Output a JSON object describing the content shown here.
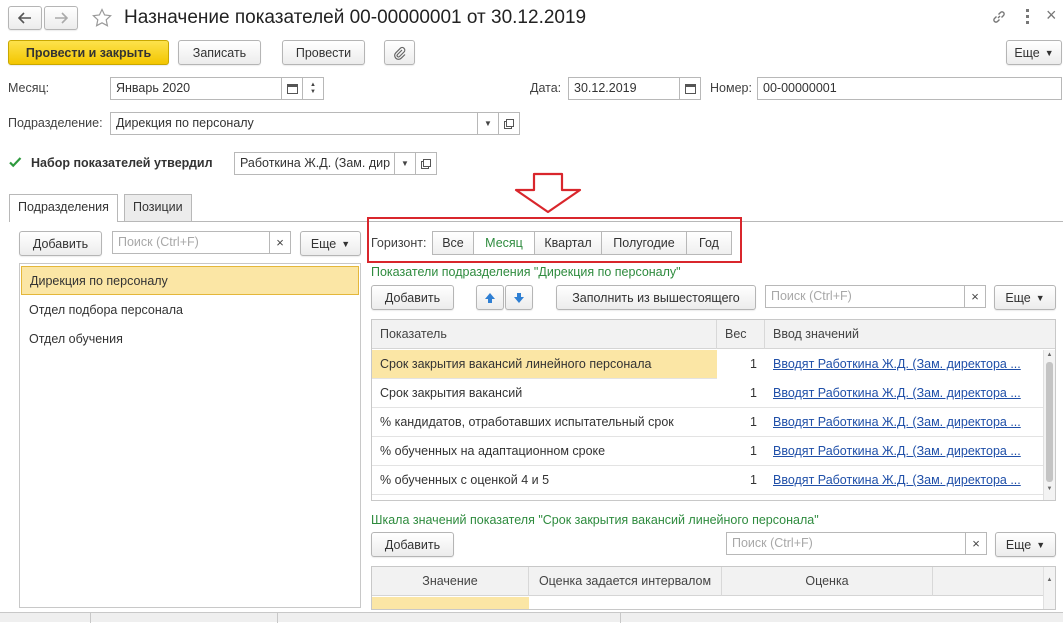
{
  "window": {
    "title": "Назначение показателей 00-00000001 от 30.12.2019"
  },
  "toolbar": {
    "post_close": "Провести и закрыть",
    "save": "Записать",
    "post": "Провести",
    "more": "Еще"
  },
  "form": {
    "month_label": "Месяц:",
    "month_value": "Январь 2020",
    "date_label": "Дата:",
    "date_value": "30.12.2019",
    "number_label": "Номер:",
    "number_value": "00-00000001",
    "dept_label": "Подразделение:",
    "dept_value": "Дирекция по персоналу",
    "approved_label": "Набор показателей утвердил",
    "approved_value": "Работкина Ж.Д. (Зам. дир"
  },
  "tabs": [
    {
      "label": "Подразделения"
    },
    {
      "label": "Позиции"
    }
  ],
  "left": {
    "add": "Добавить",
    "search_placeholder": "Поиск (Ctrl+F)",
    "more": "Еще",
    "items": [
      "Дирекция по персоналу",
      "Отдел подбора персонала",
      "Отдел обучения"
    ]
  },
  "horizon": {
    "label": "Горизонт:",
    "options": [
      "Все",
      "Месяц",
      "Квартал",
      "Полугодие",
      "Год"
    ],
    "selected": "Месяц"
  },
  "indicators": {
    "caption": "Показатели подразделения \"Дирекция по персоналу\"",
    "add": "Добавить",
    "fill": "Заполнить из вышестоящего",
    "search_placeholder": "Поиск (Ctrl+F)",
    "more": "Еще",
    "columns": [
      "Показатель",
      "Вес",
      "Ввод значений"
    ],
    "rows": [
      {
        "name": "Срок закрытия вакансий линейного персонала",
        "weight": "1",
        "input": "Вводят Работкина Ж.Д. (Зам. директора ..."
      },
      {
        "name": "Срок закрытия вакансий",
        "weight": "1",
        "input": "Вводят Работкина Ж.Д. (Зам. директора ..."
      },
      {
        "name": "% кандидатов, отработавших испытательный срок",
        "weight": "1",
        "input": "Вводят Работкина Ж.Д. (Зам. директора ..."
      },
      {
        "name": "% обученных на адаптационном сроке",
        "weight": "1",
        "input": "Вводят Работкина Ж.Д. (Зам. директора ..."
      },
      {
        "name": "% обученных с оценкой 4 и 5",
        "weight": "1",
        "input": "Вводят Работкина Ж.Д. (Зам. директора ..."
      }
    ]
  },
  "scale": {
    "caption": "Шкала значений показателя \"Срок закрытия вакансий линейного персонала\"",
    "add": "Добавить",
    "search_placeholder": "Поиск (Ctrl+F)",
    "more": "Еще",
    "columns": [
      "Значение",
      "Оценка задается интервалом",
      "Оценка"
    ]
  },
  "colors": {
    "accent_yellow": "#f3c600",
    "selected_row": "#fbe6a5",
    "green_text": "#2e8b3e",
    "link": "#1f4fa8",
    "highlight_red": "#d9262c"
  }
}
